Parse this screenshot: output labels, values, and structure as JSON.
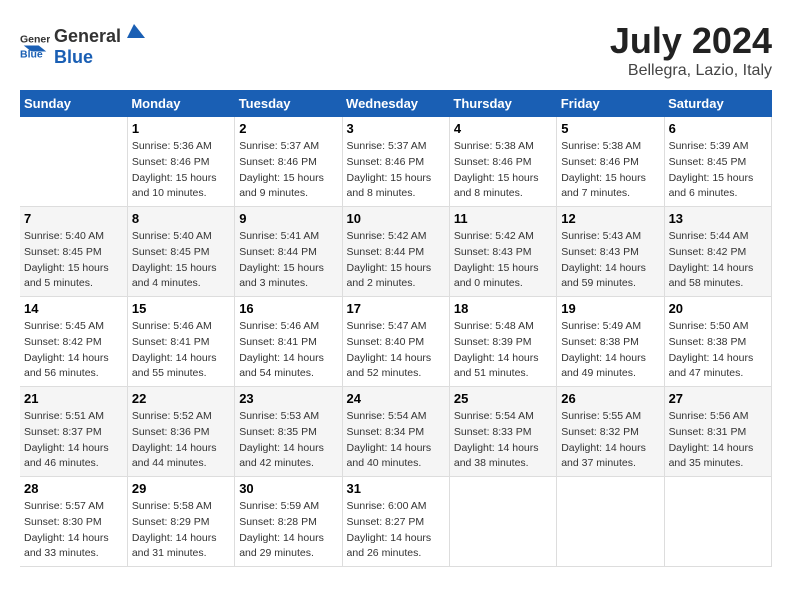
{
  "header": {
    "logo_general": "General",
    "logo_blue": "Blue",
    "title": "July 2024",
    "location": "Bellegra, Lazio, Italy"
  },
  "days_of_week": [
    "Sunday",
    "Monday",
    "Tuesday",
    "Wednesday",
    "Thursday",
    "Friday",
    "Saturday"
  ],
  "weeks": [
    [
      {
        "day": "",
        "sunrise": "",
        "sunset": "",
        "daylight": ""
      },
      {
        "day": "1",
        "sunrise": "Sunrise: 5:36 AM",
        "sunset": "Sunset: 8:46 PM",
        "daylight": "Daylight: 15 hours and 10 minutes."
      },
      {
        "day": "2",
        "sunrise": "Sunrise: 5:37 AM",
        "sunset": "Sunset: 8:46 PM",
        "daylight": "Daylight: 15 hours and 9 minutes."
      },
      {
        "day": "3",
        "sunrise": "Sunrise: 5:37 AM",
        "sunset": "Sunset: 8:46 PM",
        "daylight": "Daylight: 15 hours and 8 minutes."
      },
      {
        "day": "4",
        "sunrise": "Sunrise: 5:38 AM",
        "sunset": "Sunset: 8:46 PM",
        "daylight": "Daylight: 15 hours and 8 minutes."
      },
      {
        "day": "5",
        "sunrise": "Sunrise: 5:38 AM",
        "sunset": "Sunset: 8:46 PM",
        "daylight": "Daylight: 15 hours and 7 minutes."
      },
      {
        "day": "6",
        "sunrise": "Sunrise: 5:39 AM",
        "sunset": "Sunset: 8:45 PM",
        "daylight": "Daylight: 15 hours and 6 minutes."
      }
    ],
    [
      {
        "day": "7",
        "sunrise": "Sunrise: 5:40 AM",
        "sunset": "Sunset: 8:45 PM",
        "daylight": "Daylight: 15 hours and 5 minutes."
      },
      {
        "day": "8",
        "sunrise": "Sunrise: 5:40 AM",
        "sunset": "Sunset: 8:45 PM",
        "daylight": "Daylight: 15 hours and 4 minutes."
      },
      {
        "day": "9",
        "sunrise": "Sunrise: 5:41 AM",
        "sunset": "Sunset: 8:44 PM",
        "daylight": "Daylight: 15 hours and 3 minutes."
      },
      {
        "day": "10",
        "sunrise": "Sunrise: 5:42 AM",
        "sunset": "Sunset: 8:44 PM",
        "daylight": "Daylight: 15 hours and 2 minutes."
      },
      {
        "day": "11",
        "sunrise": "Sunrise: 5:42 AM",
        "sunset": "Sunset: 8:43 PM",
        "daylight": "Daylight: 15 hours and 0 minutes."
      },
      {
        "day": "12",
        "sunrise": "Sunrise: 5:43 AM",
        "sunset": "Sunset: 8:43 PM",
        "daylight": "Daylight: 14 hours and 59 minutes."
      },
      {
        "day": "13",
        "sunrise": "Sunrise: 5:44 AM",
        "sunset": "Sunset: 8:42 PM",
        "daylight": "Daylight: 14 hours and 58 minutes."
      }
    ],
    [
      {
        "day": "14",
        "sunrise": "Sunrise: 5:45 AM",
        "sunset": "Sunset: 8:42 PM",
        "daylight": "Daylight: 14 hours and 56 minutes."
      },
      {
        "day": "15",
        "sunrise": "Sunrise: 5:46 AM",
        "sunset": "Sunset: 8:41 PM",
        "daylight": "Daylight: 14 hours and 55 minutes."
      },
      {
        "day": "16",
        "sunrise": "Sunrise: 5:46 AM",
        "sunset": "Sunset: 8:41 PM",
        "daylight": "Daylight: 14 hours and 54 minutes."
      },
      {
        "day": "17",
        "sunrise": "Sunrise: 5:47 AM",
        "sunset": "Sunset: 8:40 PM",
        "daylight": "Daylight: 14 hours and 52 minutes."
      },
      {
        "day": "18",
        "sunrise": "Sunrise: 5:48 AM",
        "sunset": "Sunset: 8:39 PM",
        "daylight": "Daylight: 14 hours and 51 minutes."
      },
      {
        "day": "19",
        "sunrise": "Sunrise: 5:49 AM",
        "sunset": "Sunset: 8:38 PM",
        "daylight": "Daylight: 14 hours and 49 minutes."
      },
      {
        "day": "20",
        "sunrise": "Sunrise: 5:50 AM",
        "sunset": "Sunset: 8:38 PM",
        "daylight": "Daylight: 14 hours and 47 minutes."
      }
    ],
    [
      {
        "day": "21",
        "sunrise": "Sunrise: 5:51 AM",
        "sunset": "Sunset: 8:37 PM",
        "daylight": "Daylight: 14 hours and 46 minutes."
      },
      {
        "day": "22",
        "sunrise": "Sunrise: 5:52 AM",
        "sunset": "Sunset: 8:36 PM",
        "daylight": "Daylight: 14 hours and 44 minutes."
      },
      {
        "day": "23",
        "sunrise": "Sunrise: 5:53 AM",
        "sunset": "Sunset: 8:35 PM",
        "daylight": "Daylight: 14 hours and 42 minutes."
      },
      {
        "day": "24",
        "sunrise": "Sunrise: 5:54 AM",
        "sunset": "Sunset: 8:34 PM",
        "daylight": "Daylight: 14 hours and 40 minutes."
      },
      {
        "day": "25",
        "sunrise": "Sunrise: 5:54 AM",
        "sunset": "Sunset: 8:33 PM",
        "daylight": "Daylight: 14 hours and 38 minutes."
      },
      {
        "day": "26",
        "sunrise": "Sunrise: 5:55 AM",
        "sunset": "Sunset: 8:32 PM",
        "daylight": "Daylight: 14 hours and 37 minutes."
      },
      {
        "day": "27",
        "sunrise": "Sunrise: 5:56 AM",
        "sunset": "Sunset: 8:31 PM",
        "daylight": "Daylight: 14 hours and 35 minutes."
      }
    ],
    [
      {
        "day": "28",
        "sunrise": "Sunrise: 5:57 AM",
        "sunset": "Sunset: 8:30 PM",
        "daylight": "Daylight: 14 hours and 33 minutes."
      },
      {
        "day": "29",
        "sunrise": "Sunrise: 5:58 AM",
        "sunset": "Sunset: 8:29 PM",
        "daylight": "Daylight: 14 hours and 31 minutes."
      },
      {
        "day": "30",
        "sunrise": "Sunrise: 5:59 AM",
        "sunset": "Sunset: 8:28 PM",
        "daylight": "Daylight: 14 hours and 29 minutes."
      },
      {
        "day": "31",
        "sunrise": "Sunrise: 6:00 AM",
        "sunset": "Sunset: 8:27 PM",
        "daylight": "Daylight: 14 hours and 26 minutes."
      },
      {
        "day": "",
        "sunrise": "",
        "sunset": "",
        "daylight": ""
      },
      {
        "day": "",
        "sunrise": "",
        "sunset": "",
        "daylight": ""
      },
      {
        "day": "",
        "sunrise": "",
        "sunset": "",
        "daylight": ""
      }
    ]
  ]
}
